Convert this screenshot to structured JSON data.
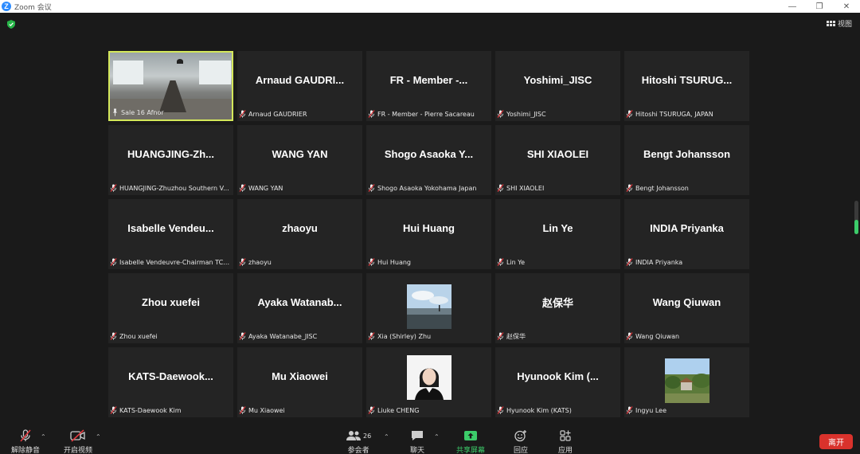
{
  "window": {
    "title": "Zoom 会议",
    "logo_letter": "Z"
  },
  "view_button": {
    "label": "视图"
  },
  "colors": {
    "active_speaker": "#d4e85a",
    "muted_mic": "#e0393e",
    "share_green": "#3ccc6a",
    "leave_red": "#d9322c"
  },
  "participants": [
    {
      "display": "",
      "label": "Sale 16 Afnor",
      "type": "video-room",
      "active": true,
      "pinned": true
    },
    {
      "display": "Arnaud GAUDRI...",
      "label": "Arnaud GAUDRIER",
      "type": "name"
    },
    {
      "display": "FR - Member -...",
      "label": "FR - Member - Pierre Sacareau",
      "type": "name"
    },
    {
      "display": "Yoshimi_JISC",
      "label": "Yoshimi_JISC",
      "type": "name"
    },
    {
      "display": "Hitoshi TSURUG...",
      "label": "Hitoshi TSURUGA, JAPAN",
      "type": "name"
    },
    {
      "display": "HUANGJING-Zh...",
      "label": "HUANGJING-Zhuzhou Southern V...",
      "type": "name"
    },
    {
      "display": "WANG YAN",
      "label": "WANG YAN",
      "type": "name"
    },
    {
      "display": "Shogo Asaoka Y...",
      "label": "Shogo Asaoka Yokohama Japan",
      "type": "name"
    },
    {
      "display": "SHI XIAOLEI",
      "label": "SHI XIAOLEI",
      "type": "name"
    },
    {
      "display": "Bengt Johansson",
      "label": "Bengt Johansson",
      "type": "name"
    },
    {
      "display": "Isabelle Vendeu...",
      "label": "Isabelle Vendeuvre-Chairman TC 2...",
      "type": "name"
    },
    {
      "display": "zhaoyu",
      "label": "zhaoyu",
      "type": "name"
    },
    {
      "display": "Hui Huang",
      "label": "Hui Huang",
      "type": "name"
    },
    {
      "display": "Lin Ye",
      "label": "Lin Ye",
      "type": "name"
    },
    {
      "display": "INDIA Priyanka",
      "label": "INDIA Priyanka",
      "type": "name"
    },
    {
      "display": "Zhou xuefei",
      "label": "Zhou xuefei",
      "type": "name"
    },
    {
      "display": "Ayaka Watanab...",
      "label": "Ayaka Watanabe_JISC",
      "type": "name"
    },
    {
      "display": "",
      "label": "Xia (Shirley) Zhu",
      "type": "photo-beach"
    },
    {
      "display": "赵保华",
      "label": "赵保华",
      "type": "name"
    },
    {
      "display": "Wang Qiuwan",
      "label": "Wang Qiuwan",
      "type": "name"
    },
    {
      "display": "KATS-Daewook...",
      "label": "KATS-Daewook Kim",
      "type": "name"
    },
    {
      "display": "Mu Xiaowei",
      "label": "Mu Xiaowei",
      "type": "name"
    },
    {
      "display": "",
      "label": "Liuke CHENG",
      "type": "photo-portrait"
    },
    {
      "display": "Hyunook Kim (...",
      "label": "Hyunook Kim (KATS)",
      "type": "name"
    },
    {
      "display": "",
      "label": "Ingyu Lee",
      "type": "photo-landscape"
    }
  ],
  "toolbar": {
    "unmute_label": "解除静音",
    "start_video_label": "开启视频",
    "participants_label": "参会者",
    "participants_count": "26",
    "chat_label": "聊天",
    "share_label": "共享屏幕",
    "reactions_label": "回应",
    "apps_label": "应用",
    "leave_label": "离开"
  }
}
